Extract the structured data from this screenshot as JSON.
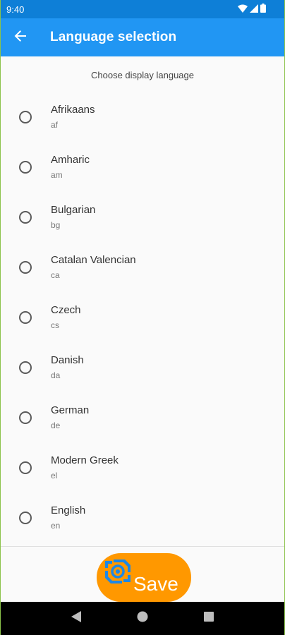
{
  "status_bar": {
    "time": "9:40",
    "icons": [
      "wifi-icon",
      "cell-signal-icon",
      "battery-icon"
    ]
  },
  "app_bar": {
    "title": "Language selection",
    "back_icon": "arrow-left-icon"
  },
  "content": {
    "subtitle": "Choose display language",
    "languages": [
      {
        "name": "Afrikaans",
        "code": "af",
        "selected": false
      },
      {
        "name": "Amharic",
        "code": "am",
        "selected": false
      },
      {
        "name": "Bulgarian",
        "code": "bg",
        "selected": false
      },
      {
        "name": "Catalan Valencian",
        "code": "ca",
        "selected": false
      },
      {
        "name": "Czech",
        "code": "cs",
        "selected": false
      },
      {
        "name": "Danish",
        "code": "da",
        "selected": false
      },
      {
        "name": "German",
        "code": "de",
        "selected": false
      },
      {
        "name": "Modern Greek",
        "code": "el",
        "selected": false
      },
      {
        "name": "English",
        "code": "en",
        "selected": false
      }
    ]
  },
  "save_button": {
    "label": "Save",
    "icon": "save-logo-icon",
    "color": "#ff9800"
  },
  "nav_bar": {
    "icons": [
      "back-triangle-icon",
      "home-circle-icon",
      "recents-square-icon"
    ]
  },
  "colors": {
    "status_bar": "#0e7fd7",
    "app_bar": "#2196f3",
    "accent": "#ff9800"
  }
}
